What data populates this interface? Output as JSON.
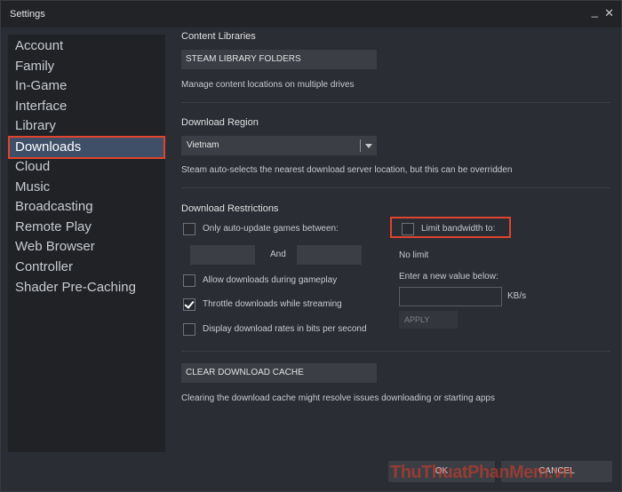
{
  "window": {
    "title": "Settings"
  },
  "sidebar": {
    "items": [
      {
        "label": "Account"
      },
      {
        "label": "Family"
      },
      {
        "label": "In-Game"
      },
      {
        "label": "Interface"
      },
      {
        "label": "Library"
      },
      {
        "label": "Downloads",
        "active": true
      },
      {
        "label": "Cloud"
      },
      {
        "label": "Music"
      },
      {
        "label": "Broadcasting"
      },
      {
        "label": "Remote Play"
      },
      {
        "label": "Web Browser"
      },
      {
        "label": "Controller"
      },
      {
        "label": "Shader Pre-Caching"
      }
    ]
  },
  "content_libraries": {
    "title": "Content Libraries",
    "button": "STEAM LIBRARY FOLDERS",
    "desc": "Manage content locations on multiple drives"
  },
  "download_region": {
    "title": "Download Region",
    "selected": "Vietnam",
    "desc": "Steam auto-selects the nearest download server location, but this can be overridden"
  },
  "download_restrictions": {
    "title": "Download Restrictions",
    "auto_update": "Only auto-update games between:",
    "and": "And",
    "allow_gameplay": "Allow downloads during gameplay",
    "throttle": "Throttle downloads while streaming",
    "bits": "Display download rates in bits per second",
    "limit_bandwidth": "Limit bandwidth to:",
    "no_limit": "No limit",
    "enter_value": "Enter a new value below:",
    "unit": "KB/s",
    "apply": "APPLY"
  },
  "cache": {
    "button": "CLEAR DOWNLOAD CACHE",
    "desc": "Clearing the download cache might resolve issues downloading or starting apps"
  },
  "footer": {
    "ok": "OK",
    "cancel": "CANCEL"
  },
  "watermark": "ThuThuatPhanMem.vn",
  "colors": {
    "accent_highlight": "#e0442c",
    "active_item_bg": "#3e4f67"
  }
}
